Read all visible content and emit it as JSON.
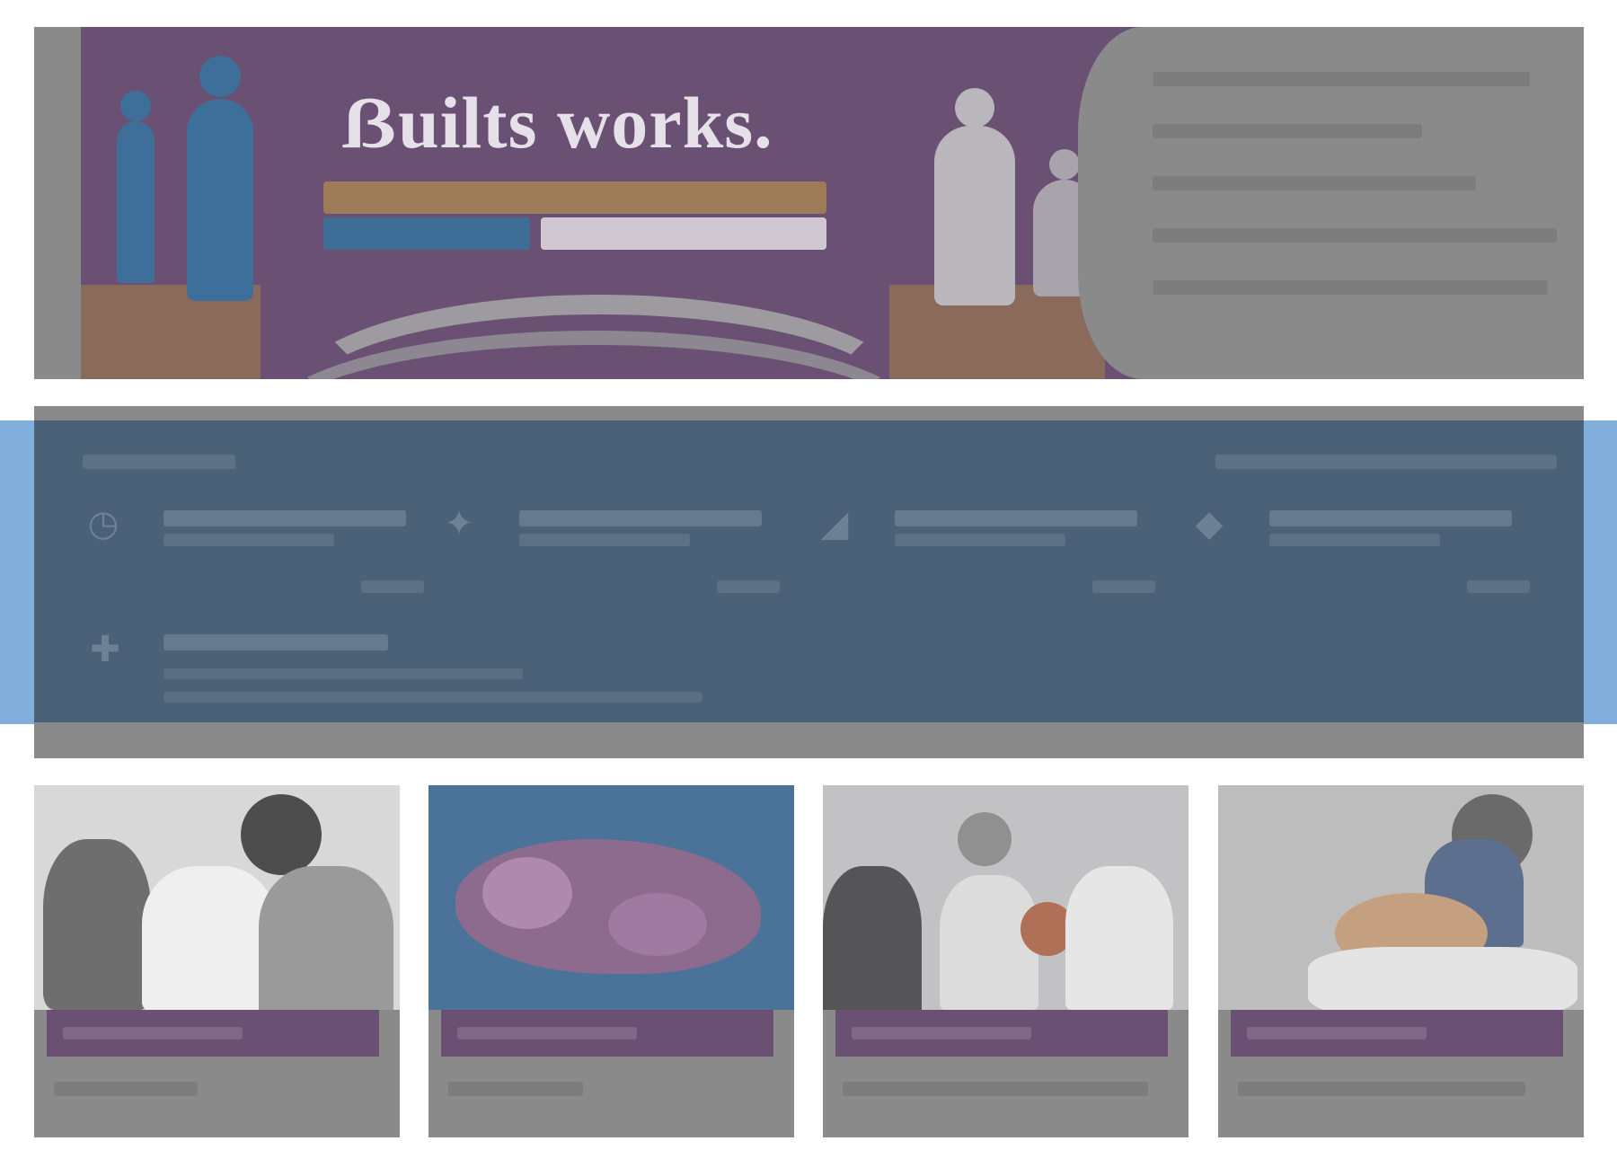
{
  "hero": {
    "title": "ẞuilts works.",
    "banner_color": "#6a5173"
  },
  "band": {
    "color": "#4b6178",
    "metrics": [
      {
        "icon": "clock-icon"
      },
      {
        "icon": "star-icon"
      },
      {
        "icon": "chart-icon"
      },
      {
        "icon": "tag-icon"
      }
    ],
    "footer_icon": "info-icon"
  },
  "cards": [
    {
      "image": "doctors-consultation-photo"
    },
    {
      "image": "us-map-illustration"
    },
    {
      "image": "team-meeting-photo"
    },
    {
      "image": "patient-care-photo"
    }
  ],
  "colors": {
    "accent_purple": "#6a5173",
    "band_blue": "#4b6178",
    "band_background": "#82aedc"
  }
}
